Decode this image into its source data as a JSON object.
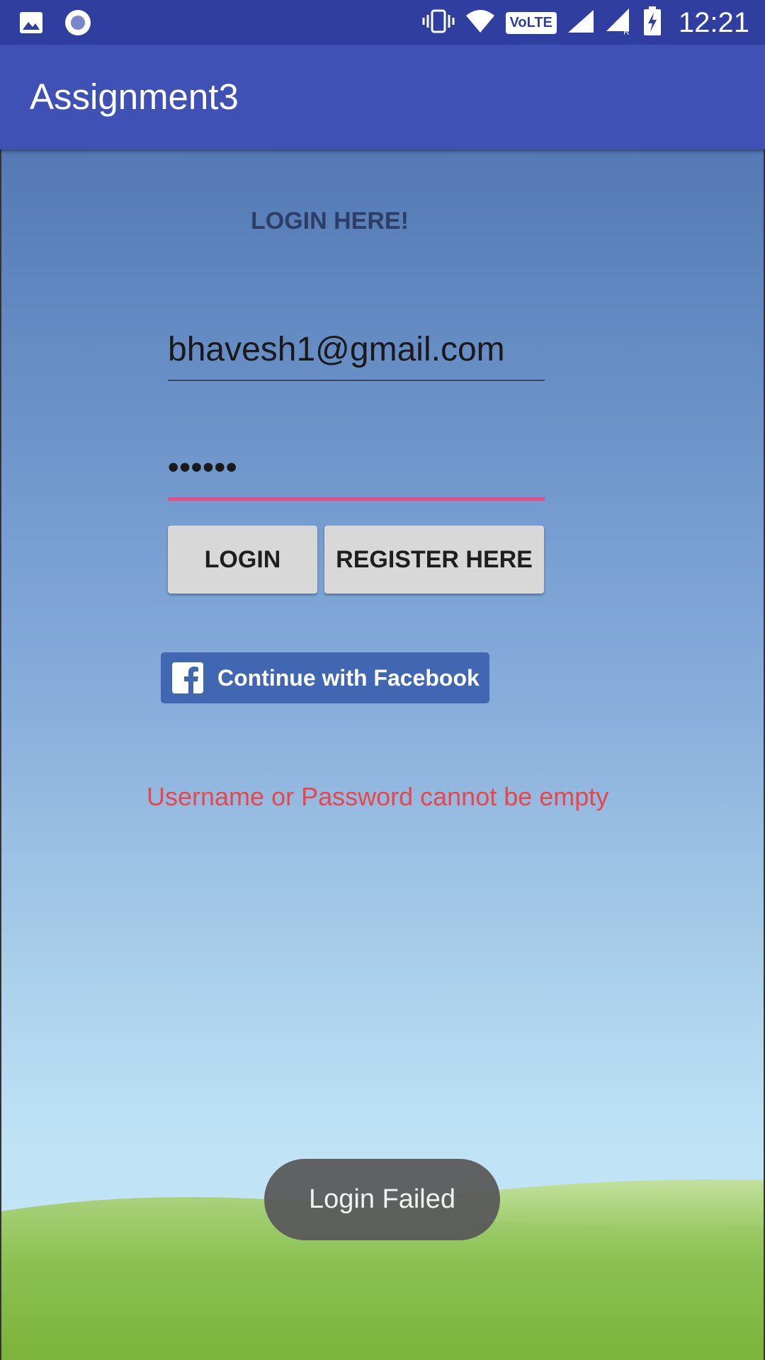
{
  "status_bar": {
    "time": "12:21",
    "network_badge": "VoLTE",
    "left_icons": [
      "image-notification-icon",
      "radio-notification-icon"
    ],
    "right_icons": [
      "vibrate-icon",
      "wifi-icon",
      "volte-icon",
      "signal-icon",
      "signal-roaming-icon",
      "battery-charging-icon"
    ]
  },
  "app_bar": {
    "title": "Assignment3"
  },
  "login": {
    "heading": "LOGIN HERE!",
    "email_value": "bhavesh1@gmail.com",
    "password_value": "••••••",
    "login_button": "LOGIN",
    "register_button": "REGISTER HERE",
    "facebook_button": "Continue with Facebook",
    "error_message": "Username or Password cannot be empty"
  },
  "toast": {
    "message": "Login Failed"
  },
  "colors": {
    "status_bar": "#303f9f",
    "app_bar": "#3f51b5",
    "accent_underline": "#e84a8a",
    "error_text": "#e8464b",
    "facebook_blue": "#4267b2"
  }
}
